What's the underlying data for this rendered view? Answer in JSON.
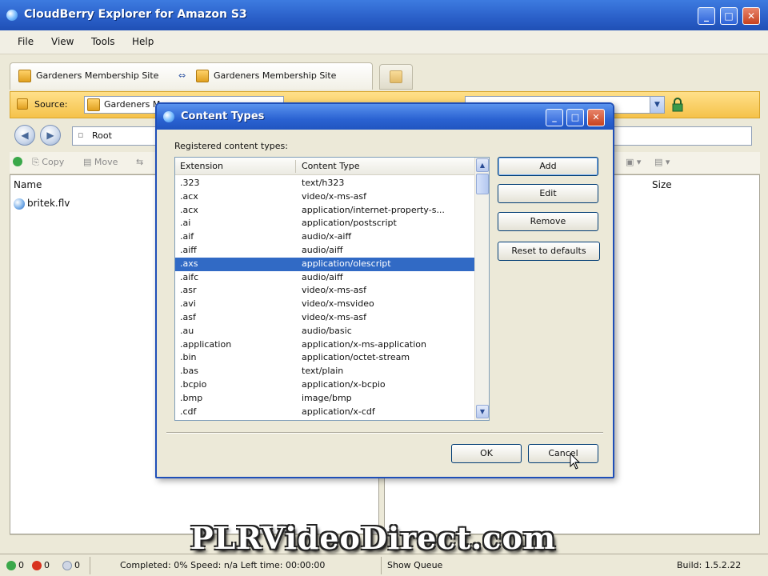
{
  "window": {
    "title": "CloudBerry Explorer for Amazon S3",
    "min_glyph": "_",
    "max_glyph": "□",
    "close_glyph": "✕"
  },
  "menu": [
    "File",
    "View",
    "Tools",
    "Help"
  ],
  "tabs": {
    "left": "Gardeners Membership Site",
    "right": "Gardeners Membership Site"
  },
  "source": {
    "label": "Source:",
    "value": "Gardeners M"
  },
  "path": {
    "value": "Root"
  },
  "toolbar": {
    "copy": "Copy",
    "move": "Move"
  },
  "left_pane": {
    "column_name": "Name",
    "files": [
      {
        "name": "britek.flv"
      }
    ]
  },
  "right_pane": {
    "column_size": "Size"
  },
  "dialog": {
    "title": "Content Types",
    "list_label": "Registered content types:",
    "columns": {
      "extension": "Extension",
      "content_type": "Content Type"
    },
    "rows": [
      {
        "ext": ".323",
        "type": "text/h323"
      },
      {
        "ext": ".acx",
        "type": "video/x-ms-asf"
      },
      {
        "ext": ".acx",
        "type": "application/internet-property-s..."
      },
      {
        "ext": ".ai",
        "type": "application/postscript"
      },
      {
        "ext": ".aif",
        "type": "audio/x-aiff"
      },
      {
        "ext": ".aiff",
        "type": "audio/aiff"
      },
      {
        "ext": ".axs",
        "type": "application/olescript"
      },
      {
        "ext": ".aifc",
        "type": "audio/aiff"
      },
      {
        "ext": ".asr",
        "type": "video/x-ms-asf"
      },
      {
        "ext": ".avi",
        "type": "video/x-msvideo"
      },
      {
        "ext": ".asf",
        "type": "video/x-ms-asf"
      },
      {
        "ext": ".au",
        "type": "audio/basic"
      },
      {
        "ext": ".application",
        "type": "application/x-ms-application"
      },
      {
        "ext": ".bin",
        "type": "application/octet-stream"
      },
      {
        "ext": ".bas",
        "type": "text/plain"
      },
      {
        "ext": ".bcpio",
        "type": "application/x-bcpio"
      },
      {
        "ext": ".bmp",
        "type": "image/bmp"
      },
      {
        "ext": ".cdf",
        "type": "application/x-cdf"
      }
    ],
    "selected_index": 6,
    "buttons": {
      "add": "Add",
      "edit": "Edit",
      "remove": "Remove",
      "reset": "Reset to defaults",
      "ok": "OK",
      "cancel": "Cancel"
    }
  },
  "status": {
    "count_ok": "0",
    "count_err": "0",
    "count_other": "0",
    "progress": "Completed: 0%  Speed: n/a  Left time: 00:00:00",
    "queue": "Show Queue",
    "build": "Build: 1.5.2.22"
  },
  "watermark": "PLRVideoDirect.com",
  "colors": {
    "titlebar": "#2a5fc8",
    "selection": "#316ac5",
    "source_bar": "#f5c24a",
    "window_bg": "#ece9d8"
  }
}
